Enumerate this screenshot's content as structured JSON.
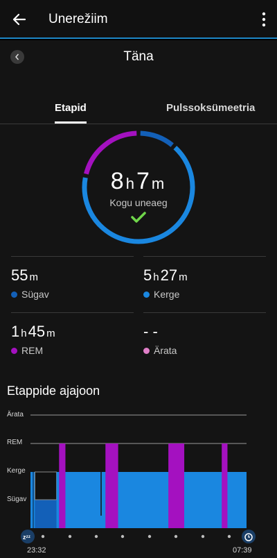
{
  "appbar": {
    "title": "Unerežiim",
    "back_icon": "arrow-left-icon",
    "more_icon": "more-vertical-icon"
  },
  "date": {
    "title": "Täna",
    "prev_icon": "chevron-left-icon"
  },
  "tabs": [
    {
      "label": "Etapid",
      "active": true
    },
    {
      "label": "Pulssoksümeetria",
      "active": false
    }
  ],
  "summary": {
    "hours": "8",
    "hours_unit": "h",
    "minutes": "7",
    "minutes_unit": "m",
    "label": "Kogu uneaeg",
    "status_icon": "checkmark-icon"
  },
  "stages": [
    {
      "key": "deep",
      "value_parts": [
        [
          "55",
          "m"
        ]
      ],
      "label": "Sügav",
      "color": "#1360b8"
    },
    {
      "key": "light",
      "value_parts": [
        [
          "5",
          "h"
        ],
        [
          "27",
          "m"
        ]
      ],
      "label": "Kerge",
      "color": "#1a87e0"
    },
    {
      "key": "rem",
      "value_parts": [
        [
          "1",
          "h"
        ],
        [
          "45",
          "m"
        ]
      ],
      "label": "REM",
      "color": "#a411c0"
    },
    {
      "key": "awake",
      "value_parts": [
        [
          "- -",
          ""
        ]
      ],
      "label": "Ärata",
      "color": "#e07fc8"
    }
  ],
  "ring": {
    "segments": [
      {
        "stage": "deep",
        "minutes": 55
      },
      {
        "stage": "light",
        "minutes": 327
      },
      {
        "stage": "rem",
        "minutes": 105
      }
    ]
  },
  "timeline": {
    "title": "Etappide ajajoon",
    "levels": [
      "Ärata",
      "REM",
      "Kerge",
      "Sügav"
    ],
    "start_time": "23:32",
    "end_time": "07:39",
    "start_icon": "sleep-zzz-icon",
    "end_icon": "alarm-clock-icon",
    "blocks": [
      {
        "stage": "light",
        "start": 0,
        "end": 7
      },
      {
        "stage": "deep",
        "start": 7,
        "end": 41
      },
      {
        "stage": "light",
        "start": 41,
        "end": 45
      },
      {
        "stage": "rem",
        "start": 45,
        "end": 55
      },
      {
        "stage": "light",
        "start": 55,
        "end": 118
      },
      {
        "stage": "rem",
        "start": 118,
        "end": 138
      },
      {
        "stage": "light",
        "start": 138,
        "end": 217
      },
      {
        "stage": "rem",
        "start": 217,
        "end": 242
      },
      {
        "stage": "light",
        "start": 242,
        "end": 301
      },
      {
        "stage": "rem",
        "start": 301,
        "end": 310
      },
      {
        "stage": "light",
        "start": 310,
        "end": 340
      }
    ]
  }
}
